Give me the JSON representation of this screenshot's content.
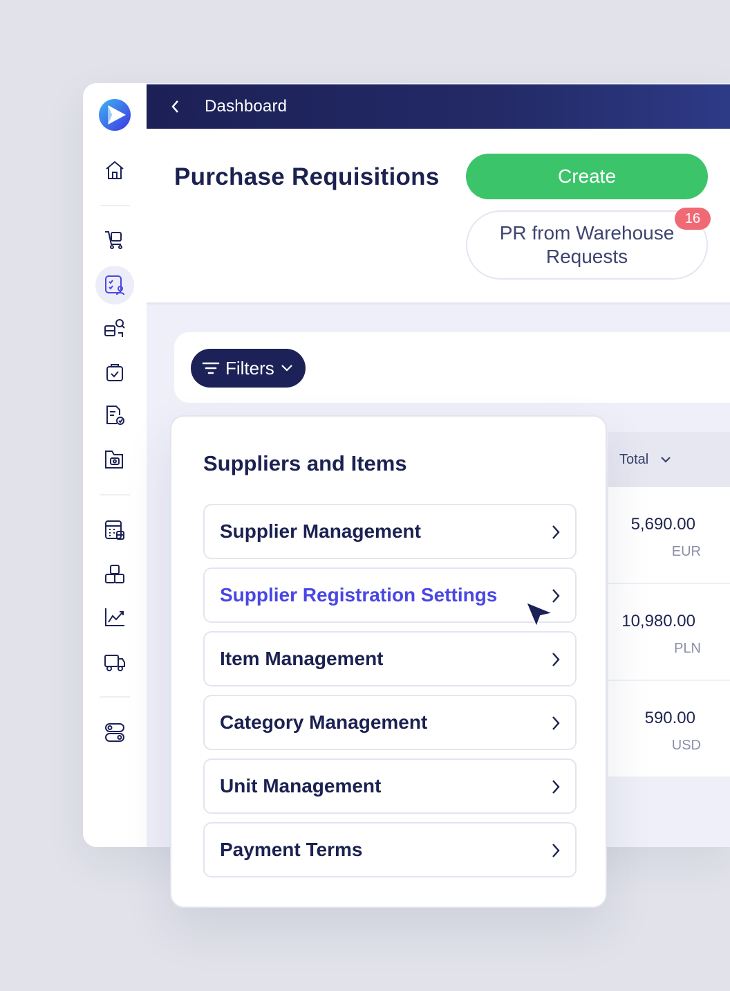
{
  "topbar": {
    "back_icon": "chevron-left-icon",
    "title": "Dashboard"
  },
  "header": {
    "title": "Purchase Requisitions",
    "create_label": "Create",
    "pr_button_label": "PR from Warehouse Requests",
    "pr_badge_count": "16"
  },
  "filters": {
    "label": "Filters"
  },
  "table": {
    "total_header": "Total",
    "rows": [
      {
        "amount": "5,690.00",
        "currency": "EUR"
      },
      {
        "amount": "10,980.00",
        "currency": "PLN"
      },
      {
        "amount": "590.00",
        "currency": "USD"
      }
    ]
  },
  "panel": {
    "title": "Suppliers and Items",
    "items": [
      {
        "label": "Supplier Management"
      },
      {
        "label": "Supplier Registration Settings",
        "highlighted": true
      },
      {
        "label": "Item Management"
      },
      {
        "label": "Category Management"
      },
      {
        "label": "Unit Management"
      },
      {
        "label": "Payment Terms"
      }
    ]
  },
  "sidebar": {
    "icons": [
      "home-icon",
      "cart-icon",
      "requisition-icon",
      "search-supplier-icon",
      "bag-check-icon",
      "document-check-icon",
      "folder-camera-icon",
      "calculator-icon",
      "boxes-icon",
      "chart-icon",
      "truck-icon",
      "toggle-icon"
    ],
    "active": "requisition-icon"
  },
  "colors": {
    "navy": "#1c2056",
    "create_green": "#3cc46b",
    "badge_red": "#f06a76",
    "highlight_blue": "#4a46e4"
  }
}
